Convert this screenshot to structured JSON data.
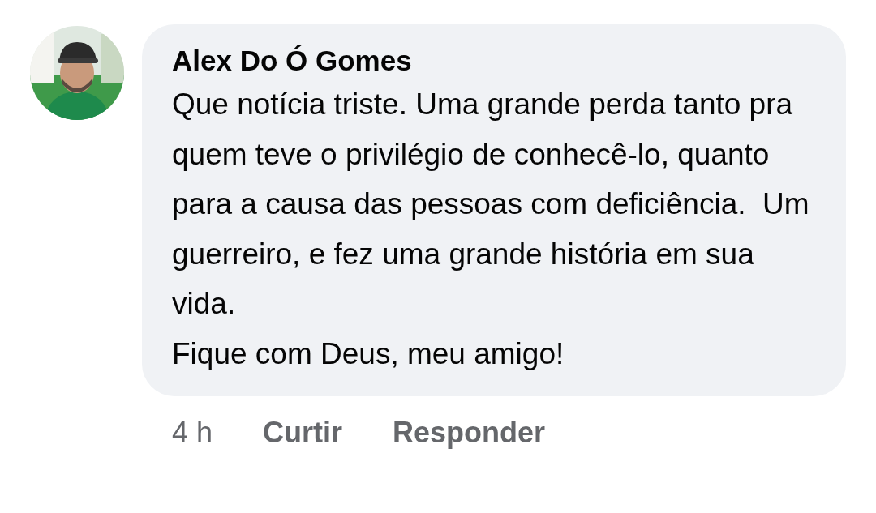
{
  "comment": {
    "author": "Alex Do Ó Gomes",
    "paragraphs": [
      "Que notícia triste. Uma grande perda tanto pra quem teve o privilégio de conhecê-lo, quanto para a causa das pessoas com deficiência.  Um guerreiro, e fez uma grande história em sua vida.",
      "Fique com Deus, meu amigo!"
    ],
    "time": "4 h",
    "actions": [
      "Curtir",
      "Responder"
    ]
  }
}
